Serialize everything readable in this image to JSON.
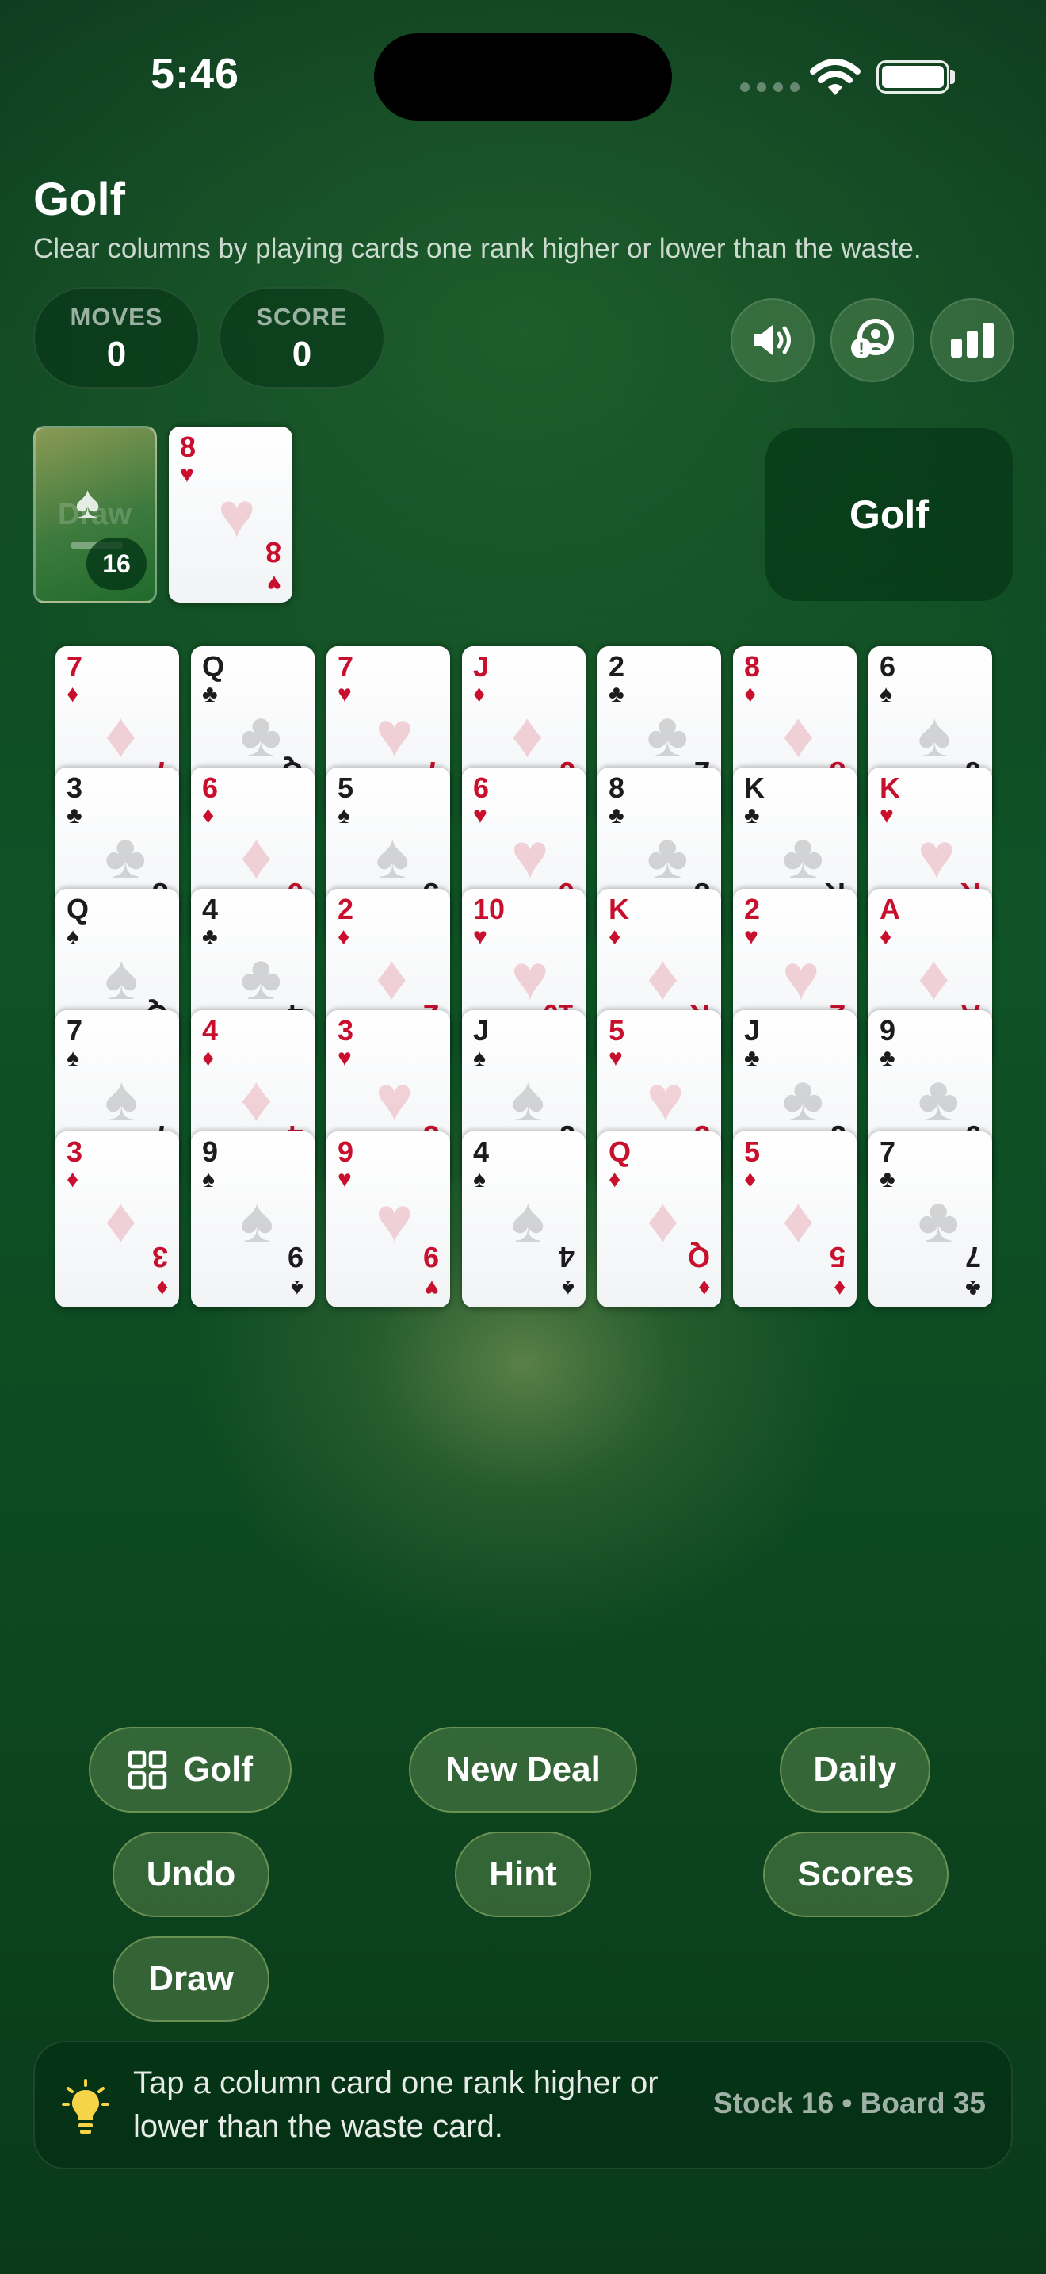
{
  "status_bar": {
    "time": "5:46"
  },
  "header": {
    "title": "Golf",
    "subtitle": "Clear columns by playing cards one rank higher or lower than the waste."
  },
  "stats": {
    "moves_label": "MOVES",
    "moves_value": "0",
    "score_label": "SCORE",
    "score_value": "0"
  },
  "icons": {
    "sound": "speaker-icon",
    "help": "help-icon",
    "stats": "bar-chart-icon"
  },
  "stock": {
    "count": "16",
    "ghost_label": "Draw"
  },
  "waste": {
    "rank": "8",
    "suit": "♥",
    "color": "red"
  },
  "mode_badge": "Golf",
  "tableau": [
    [
      {
        "rank": "7",
        "suit": "♦",
        "color": "red"
      },
      {
        "rank": "3",
        "suit": "♣",
        "color": "black"
      },
      {
        "rank": "Q",
        "suit": "♠",
        "color": "black"
      },
      {
        "rank": "7",
        "suit": "♠",
        "color": "black"
      },
      {
        "rank": "3",
        "suit": "♦",
        "color": "red"
      }
    ],
    [
      {
        "rank": "Q",
        "suit": "♣",
        "color": "black"
      },
      {
        "rank": "6",
        "suit": "♦",
        "color": "red"
      },
      {
        "rank": "4",
        "suit": "♣",
        "color": "black"
      },
      {
        "rank": "4",
        "suit": "♦",
        "color": "red"
      },
      {
        "rank": "9",
        "suit": "♠",
        "color": "black"
      }
    ],
    [
      {
        "rank": "7",
        "suit": "♥",
        "color": "red"
      },
      {
        "rank": "5",
        "suit": "♠",
        "color": "black"
      },
      {
        "rank": "2",
        "suit": "♦",
        "color": "red"
      },
      {
        "rank": "3",
        "suit": "♥",
        "color": "red"
      },
      {
        "rank": "9",
        "suit": "♥",
        "color": "red"
      }
    ],
    [
      {
        "rank": "J",
        "suit": "♦",
        "color": "red"
      },
      {
        "rank": "6",
        "suit": "♥",
        "color": "red"
      },
      {
        "rank": "10",
        "suit": "♥",
        "color": "red"
      },
      {
        "rank": "J",
        "suit": "♠",
        "color": "black"
      },
      {
        "rank": "4",
        "suit": "♠",
        "color": "black"
      }
    ],
    [
      {
        "rank": "2",
        "suit": "♣",
        "color": "black"
      },
      {
        "rank": "8",
        "suit": "♣",
        "color": "black"
      },
      {
        "rank": "K",
        "suit": "♦",
        "color": "red"
      },
      {
        "rank": "5",
        "suit": "♥",
        "color": "red"
      },
      {
        "rank": "Q",
        "suit": "♦",
        "color": "red"
      }
    ],
    [
      {
        "rank": "8",
        "suit": "♦",
        "color": "red"
      },
      {
        "rank": "K",
        "suit": "♣",
        "color": "black"
      },
      {
        "rank": "2",
        "suit": "♥",
        "color": "red"
      },
      {
        "rank": "J",
        "suit": "♣",
        "color": "black"
      },
      {
        "rank": "5",
        "suit": "♦",
        "color": "red"
      }
    ],
    [
      {
        "rank": "6",
        "suit": "♠",
        "color": "black"
      },
      {
        "rank": "K",
        "suit": "♥",
        "color": "red"
      },
      {
        "rank": "A",
        "suit": "♦",
        "color": "red"
      },
      {
        "rank": "9",
        "suit": "♣",
        "color": "black"
      },
      {
        "rank": "7",
        "suit": "♣",
        "color": "black"
      }
    ]
  ],
  "buttons": {
    "golf": "Golf",
    "new_deal": "New Deal",
    "daily": "Daily",
    "undo": "Undo",
    "hint": "Hint",
    "scores": "Scores",
    "draw": "Draw"
  },
  "hint_bar": {
    "text": "Tap a column card one rank higher or lower than the waste card.",
    "stats": "Stock 16 • Board 35"
  },
  "colors": {
    "red_suit": "#c8102e",
    "black_suit": "#1c1c1e",
    "felt": "#0f5326"
  }
}
